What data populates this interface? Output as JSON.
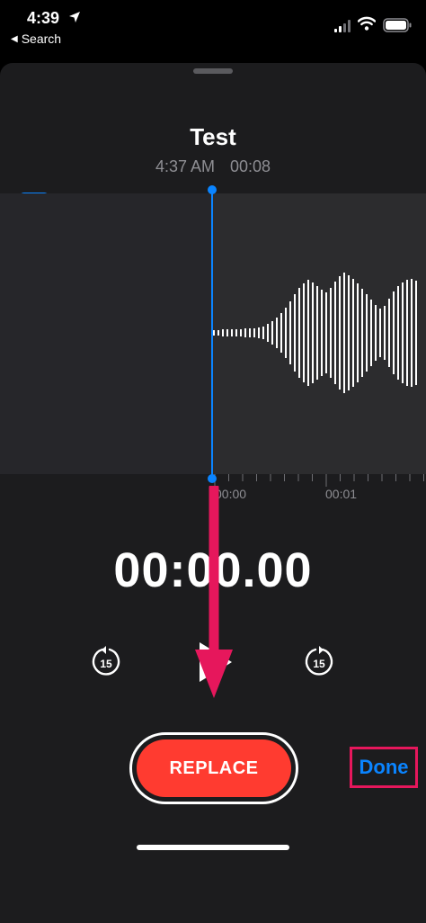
{
  "status_bar": {
    "time": "4:39",
    "back_label": "Search",
    "back_arrow": "◀"
  },
  "recording": {
    "title": "Test",
    "time": "4:37 AM",
    "duration": "00:08"
  },
  "timeline": {
    "tick_labels": [
      "00:00",
      "00:01"
    ]
  },
  "timer": "00:00.00",
  "controls": {
    "skip_back_label": "15",
    "skip_forward_label": "15"
  },
  "actions": {
    "replace_label": "REPLACE",
    "done_label": "Done"
  },
  "colors": {
    "accent": "#0a84ff",
    "replace": "#ff3b30",
    "annotation": "#e6175c",
    "sheet": "#1c1c1e"
  },
  "icons": {
    "enhance": "enhance-wand-icon",
    "crop": "crop-icon",
    "play": "play-icon",
    "skip_back": "skip-back-15-icon",
    "skip_forward": "skip-forward-15-icon"
  }
}
